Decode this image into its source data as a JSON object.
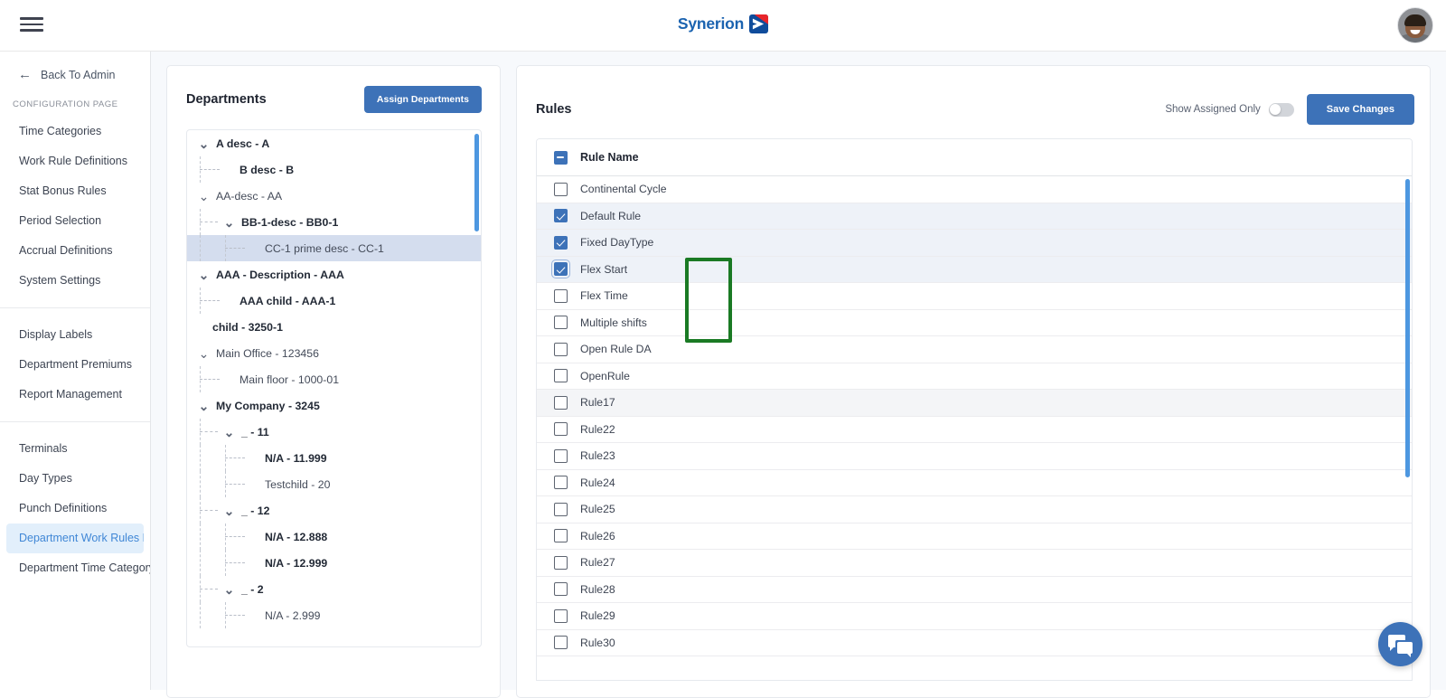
{
  "app": {
    "brand_name": "Synerion",
    "logo_icon": "synerion-chevron-mark",
    "menu_icon": "hamburger-icon",
    "avatar_icon": "user-avatar"
  },
  "sidebar": {
    "back_label": "Back To Admin",
    "back_icon": "arrow-left-icon",
    "section_caption": "CONFIGURATION PAGE",
    "groups": [
      {
        "items": [
          {
            "label": "Time Categories",
            "active": false
          },
          {
            "label": "Work Rule Definitions",
            "active": false
          },
          {
            "label": "Stat Bonus Rules",
            "active": false
          },
          {
            "label": "Period Selection",
            "active": false
          },
          {
            "label": "Accrual Definitions",
            "active": false
          },
          {
            "label": "System Settings",
            "active": false
          }
        ]
      },
      {
        "items": [
          {
            "label": "Display Labels",
            "active": false
          },
          {
            "label": "Department Premiums",
            "active": false
          },
          {
            "label": "Report Management",
            "active": false
          }
        ]
      },
      {
        "items": [
          {
            "label": "Terminals",
            "active": false
          },
          {
            "label": "Day Types",
            "active": false
          },
          {
            "label": "Punch Definitions",
            "active": false
          },
          {
            "label": "Department Work Rules Filt...",
            "active": true
          },
          {
            "label": "Department Time Category ...",
            "active": false
          }
        ]
      }
    ]
  },
  "departments": {
    "title": "Departments",
    "assign_button": "Assign Departments",
    "expand_icon": "chevron-down-icon",
    "tree": [
      {
        "label": "A desc - A",
        "depth": 0,
        "bold": true,
        "expander": true,
        "selected": false
      },
      {
        "label": "B desc - B",
        "depth": 1,
        "bold": true,
        "expander": false,
        "selected": false
      },
      {
        "label": "AA-desc - AA",
        "depth": 0,
        "bold": false,
        "expander": true,
        "selected": false
      },
      {
        "label": "BB-1-desc - BB0-1",
        "depth": 1,
        "bold": true,
        "expander": true,
        "selected": false
      },
      {
        "label": "CC-1 prime desc - CC-1",
        "depth": 2,
        "bold": false,
        "expander": false,
        "selected": true
      },
      {
        "label": "AAA - Description - AAA",
        "depth": 0,
        "bold": true,
        "expander": true,
        "selected": false
      },
      {
        "label": "AAA child - AAA-1",
        "depth": 1,
        "bold": true,
        "expander": false,
        "selected": false
      },
      {
        "label": "child - 3250-1",
        "depth": 0,
        "bold": true,
        "expander": false,
        "selected": false,
        "noline": true
      },
      {
        "label": "Main Office - 123456",
        "depth": 0,
        "bold": false,
        "expander": true,
        "selected": false
      },
      {
        "label": "Main floor - 1000-01",
        "depth": 1,
        "bold": false,
        "expander": false,
        "selected": false
      },
      {
        "label": "My Company - 3245",
        "depth": 0,
        "bold": true,
        "expander": true,
        "selected": false
      },
      {
        "label": "_ - 11",
        "depth": 1,
        "bold": true,
        "expander": true,
        "selected": false
      },
      {
        "label": "N/A - 11.999",
        "depth": 2,
        "bold": true,
        "expander": false,
        "selected": false
      },
      {
        "label": "Testchild - 20",
        "depth": 2,
        "bold": false,
        "expander": false,
        "selected": false
      },
      {
        "label": "_ - 12",
        "depth": 1,
        "bold": true,
        "expander": true,
        "selected": false
      },
      {
        "label": "N/A - 12.888",
        "depth": 2,
        "bold": true,
        "expander": false,
        "selected": false
      },
      {
        "label": "N/A - 12.999",
        "depth": 2,
        "bold": true,
        "expander": false,
        "selected": false
      },
      {
        "label": "_ - 2",
        "depth": 1,
        "bold": true,
        "expander": true,
        "selected": false
      },
      {
        "label": "N/A - 2.999",
        "depth": 2,
        "bold": false,
        "expander": false,
        "selected": false
      }
    ]
  },
  "rules": {
    "title": "Rules",
    "toggle_label": "Show Assigned Only",
    "toggle_on": false,
    "save_button": "Save Changes",
    "column_header": "Rule Name",
    "header_checkbox_state": "indeterminate",
    "items": [
      {
        "name": "Continental Cycle",
        "checked": false
      },
      {
        "name": "Default Rule",
        "checked": true
      },
      {
        "name": "Fixed DayType",
        "checked": true
      },
      {
        "name": "Flex Start",
        "checked": true,
        "focused": true
      },
      {
        "name": "Flex Time",
        "checked": false
      },
      {
        "name": "Multiple shifts",
        "checked": false
      },
      {
        "name": "Open Rule DA",
        "checked": false
      },
      {
        "name": "OpenRule",
        "checked": false
      },
      {
        "name": "Rule17",
        "checked": false,
        "alt": true
      },
      {
        "name": "Rule22",
        "checked": false
      },
      {
        "name": "Rule23",
        "checked": false
      },
      {
        "name": "Rule24",
        "checked": false
      },
      {
        "name": "Rule25",
        "checked": false
      },
      {
        "name": "Rule26",
        "checked": false
      },
      {
        "name": "Rule27",
        "checked": false
      },
      {
        "name": "Rule28",
        "checked": false
      },
      {
        "name": "Rule29",
        "checked": false
      },
      {
        "name": "Rule30",
        "checked": false
      }
    ]
  },
  "chat": {
    "icon": "chat-bubbles-icon"
  },
  "colors": {
    "accent": "#3d72b8",
    "brand_blue": "#1b63b0",
    "brand_red": "#e8252a",
    "annotation_green": "#1a7a24",
    "scrollbar": "#4d97e0",
    "selected_row": "#d4ddee"
  }
}
